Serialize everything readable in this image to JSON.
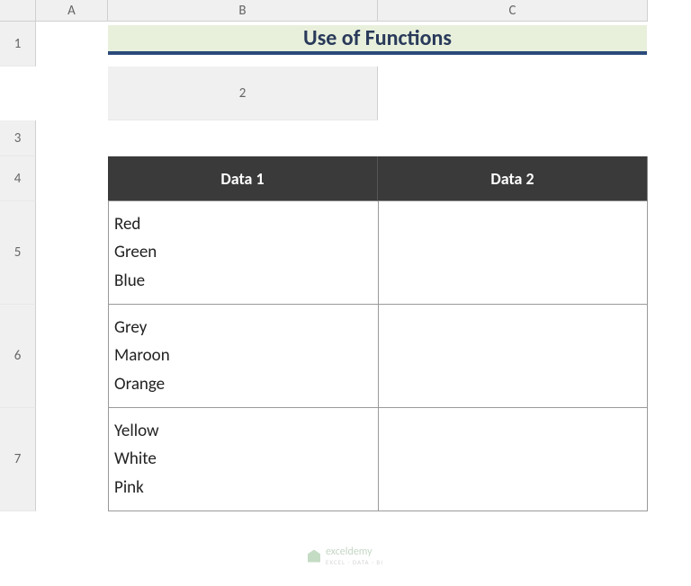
{
  "columns": [
    "A",
    "B",
    "C"
  ],
  "rows": [
    "1",
    "2",
    "3",
    "4",
    "5",
    "6",
    "7"
  ],
  "title": "Use of Functions",
  "table": {
    "headers": [
      "Data 1",
      "Data 2"
    ],
    "rows": [
      {
        "data1_lines": [
          "Red",
          "Green",
          "Blue"
        ],
        "data2": ""
      },
      {
        "data1_lines": [
          "Grey",
          "Maroon",
          "Orange"
        ],
        "data2": ""
      },
      {
        "data1_lines": [
          "Yellow",
          "White",
          "Pink"
        ],
        "data2": ""
      }
    ]
  },
  "watermark": {
    "name": "exceldemy",
    "sub": "EXCEL · DATA · BI"
  }
}
